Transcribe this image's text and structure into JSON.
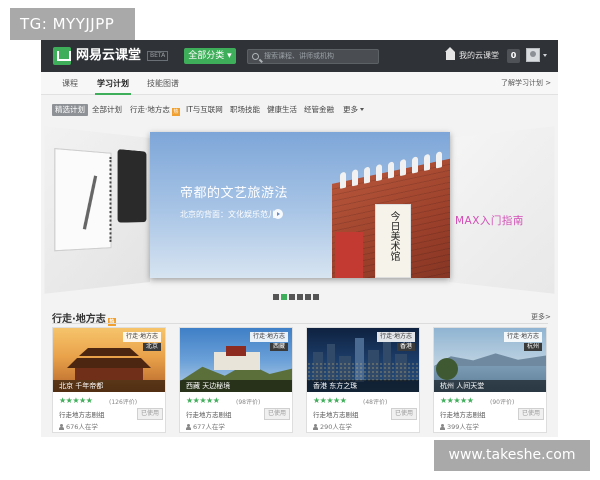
{
  "watermarks": {
    "tag": "TG: MYYJJPP",
    "site": "www.takeshe.com"
  },
  "topbar": {
    "brand": "网易云课堂",
    "beta": "BETA",
    "category_button": "全部分类 ▾",
    "search_placeholder": "搜索课程、讲师或机构",
    "my_class": "我的云课堂",
    "message_count": "0"
  },
  "nav": {
    "tabs": [
      {
        "label": "课程",
        "active": false
      },
      {
        "label": "学习计划",
        "active": true
      },
      {
        "label": "技能图谱",
        "active": false
      }
    ],
    "learn_link": "了解学习计划 >"
  },
  "categories": {
    "items": [
      "精选计划",
      "全部计划",
      "行走·地方志",
      "IT与互联网",
      "职场技能",
      "健康生活",
      "经管金融",
      "更多"
    ],
    "selected": "精选计划",
    "hot_badge": "热"
  },
  "carousel": {
    "slide_title": "帝都的文艺旅游法",
    "slide_subtitle": "北京的背面：文化娱乐范儿",
    "sign_text": "今日美术馆",
    "right_peek_text": "MAX入门指南",
    "pages": 6,
    "active_page": 2
  },
  "section": {
    "title": "行走·地方志",
    "hot_badge": "热",
    "more_label": "更多>"
  },
  "cards": [
    {
      "tag": "行走·地方志",
      "location": "北京",
      "caption": "北京 千年帝都",
      "stars": "★★★★★",
      "rating_count": "(126评价)",
      "institution": "行走地方志剧组",
      "learners": "676人在学",
      "button": "已使用"
    },
    {
      "tag": "行走·地方志",
      "location": "西藏",
      "caption": "西藏 天边秘境",
      "stars": "★★★★★",
      "rating_count": "(98评价)",
      "institution": "行走地方志剧组",
      "learners": "677人在学",
      "button": "已使用"
    },
    {
      "tag": "行走·地方志",
      "location": "香港",
      "caption": "香港 东方之珠",
      "stars": "★★★★★",
      "rating_count": "(48评价)",
      "institution": "行走地方志剧组",
      "learners": "290人在学",
      "button": "已使用"
    },
    {
      "tag": "行走·地方志",
      "location": "杭州",
      "caption": "杭州 人间天堂",
      "stars": "★★★★★",
      "rating_count": "(90评价)",
      "institution": "行走地方志剧组",
      "learners": "399人在学",
      "button": "已使用"
    }
  ],
  "colors": {
    "accent": "#3fae5a",
    "topbar": "#2f3236",
    "badge": "#f0a030",
    "peek_text": "#d24fb6"
  },
  "icons": {
    "logo": "logo-icon",
    "search": "search-icon",
    "home": "home-icon",
    "avatar": "avatar-icon",
    "person": "person-icon"
  }
}
